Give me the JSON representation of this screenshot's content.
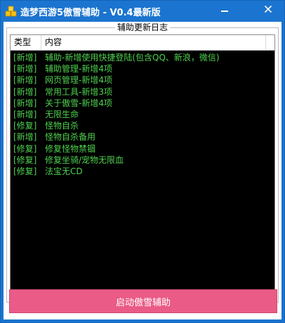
{
  "window": {
    "title": "造梦西游5傲雪辅助 - V0.4最新版",
    "icon": "coins-icon",
    "accent_color": "#1b74cf"
  },
  "changelog": {
    "group_title": "辅助更新日志",
    "columns": {
      "type": "类型",
      "content": "内容"
    },
    "entry_color": "#4fd24f",
    "rows": [
      {
        "type": "[新增]",
        "content": "辅助-新增使用快捷登陆(包含QQ、新浪，微信)"
      },
      {
        "type": "[新增]",
        "content": "辅助管理-新增4项"
      },
      {
        "type": "[新增]",
        "content": "网页管理-新增4项"
      },
      {
        "type": "[新增]",
        "content": "常用工具-新增3项"
      },
      {
        "type": "[新增]",
        "content": "关于傲雪-新增4项"
      },
      {
        "type": "[新增]",
        "content": "无限生命"
      },
      {
        "type": "[修复]",
        "content": "怪物自杀"
      },
      {
        "type": "[新增]",
        "content": "怪物自杀备用"
      },
      {
        "type": "[修复]",
        "content": "修复怪物禁锢"
      },
      {
        "type": "[修复]",
        "content": "修复坐骑/宠物无限血"
      },
      {
        "type": "[修复]",
        "content": "法宝无CD"
      }
    ]
  },
  "actions": {
    "start_label": "启动傲雪辅助",
    "start_color": "#ea5b87"
  }
}
